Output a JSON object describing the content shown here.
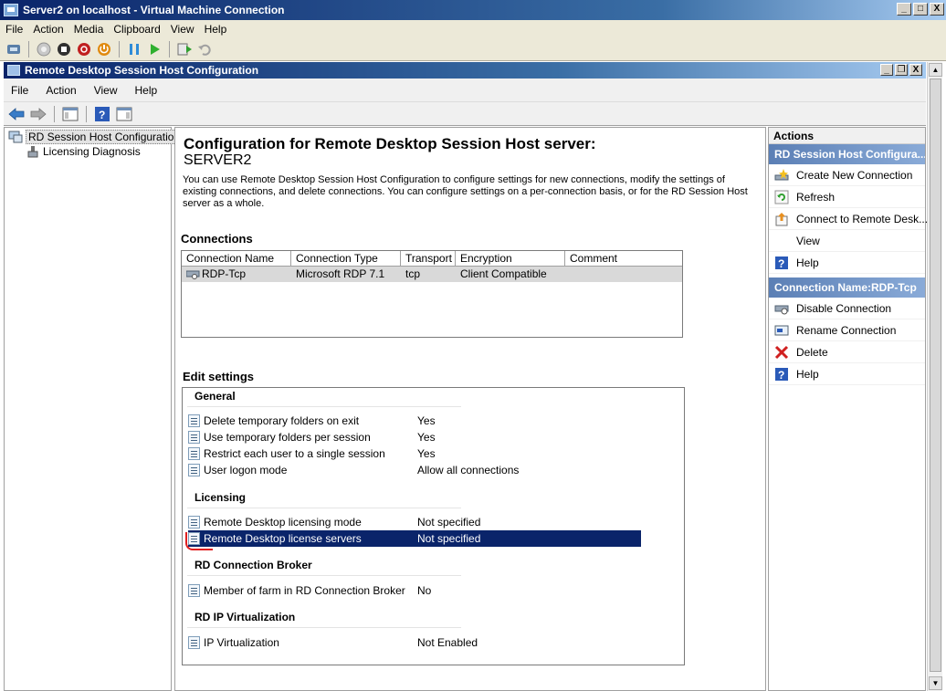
{
  "vm_window": {
    "title": "Server2 on localhost - Virtual Machine Connection",
    "menu": [
      "File",
      "Action",
      "Media",
      "Clipboard",
      "View",
      "Help"
    ],
    "caption_min": "_",
    "caption_max": "□",
    "caption_close": "X"
  },
  "mmc_window": {
    "title": "Remote Desktop Session Host Configuration",
    "menu": [
      "File",
      "Action",
      "View",
      "Help"
    ],
    "caption_min": "_",
    "caption_restore": "❐",
    "caption_close": "X"
  },
  "tree": {
    "root": "RD Session Host Configuration:",
    "child": "Licensing Diagnosis"
  },
  "content": {
    "title": "Configuration for Remote Desktop Session Host server:",
    "server": "SERVER2",
    "description": "You can use Remote Desktop Session Host Configuration to configure settings for new connections, modify the settings of existing connections, and delete connections. You can configure settings on a per-connection basis, or for the RD Session Host server as a whole.",
    "connections_heading": "Connections",
    "columns": [
      "Connection Name",
      "Connection Type",
      "Transport",
      "Encryption",
      "Comment"
    ],
    "rows": [
      [
        "RDP-Tcp",
        "Microsoft RDP 7.1",
        "tcp",
        "Client Compatible",
        ""
      ]
    ],
    "edit_heading": "Edit settings",
    "groups": [
      {
        "name": "General",
        "settings": [
          {
            "name": "Delete temporary folders on exit",
            "value": "Yes"
          },
          {
            "name": "Use temporary folders per session",
            "value": "Yes"
          },
          {
            "name": "Restrict each user to a single session",
            "value": "Yes"
          },
          {
            "name": "User logon mode",
            "value": "Allow all connections"
          }
        ]
      },
      {
        "name": "Licensing",
        "settings": [
          {
            "name": "Remote Desktop licensing mode",
            "value": "Not specified"
          },
          {
            "name": "Remote Desktop license servers",
            "value": "Not specified"
          }
        ]
      },
      {
        "name": "RD Connection Broker",
        "settings": [
          {
            "name": "Member of farm in RD Connection Broker",
            "value": "No"
          }
        ]
      },
      {
        "name": "RD IP Virtualization",
        "settings": [
          {
            "name": "IP Virtualization",
            "value": "Not Enabled"
          }
        ]
      }
    ]
  },
  "actions": {
    "heading": "Actions",
    "section1": "RD Session Host Configura...",
    "section1_items": [
      {
        "label": "Create New Connection",
        "icon": "create-connection-icon"
      },
      {
        "label": "Refresh",
        "icon": "refresh-icon"
      },
      {
        "label": "Connect to Remote Desk...",
        "icon": "connect-remote-icon"
      },
      {
        "label": "View",
        "icon": ""
      },
      {
        "label": "Help",
        "icon": "help-icon"
      }
    ],
    "section2": "Connection Name:RDP-Tcp",
    "section2_items": [
      {
        "label": "Disable Connection",
        "icon": "disable-connection-icon"
      },
      {
        "label": "Rename Connection",
        "icon": "rename-icon"
      },
      {
        "label": "Delete",
        "icon": "delete-icon"
      },
      {
        "label": "Help",
        "icon": "help-icon"
      }
    ]
  },
  "colors": {
    "title_bar": "#0a246a",
    "selection": "#0a246a",
    "action_section": "#5b7fb5",
    "annotation": "#e02020"
  }
}
